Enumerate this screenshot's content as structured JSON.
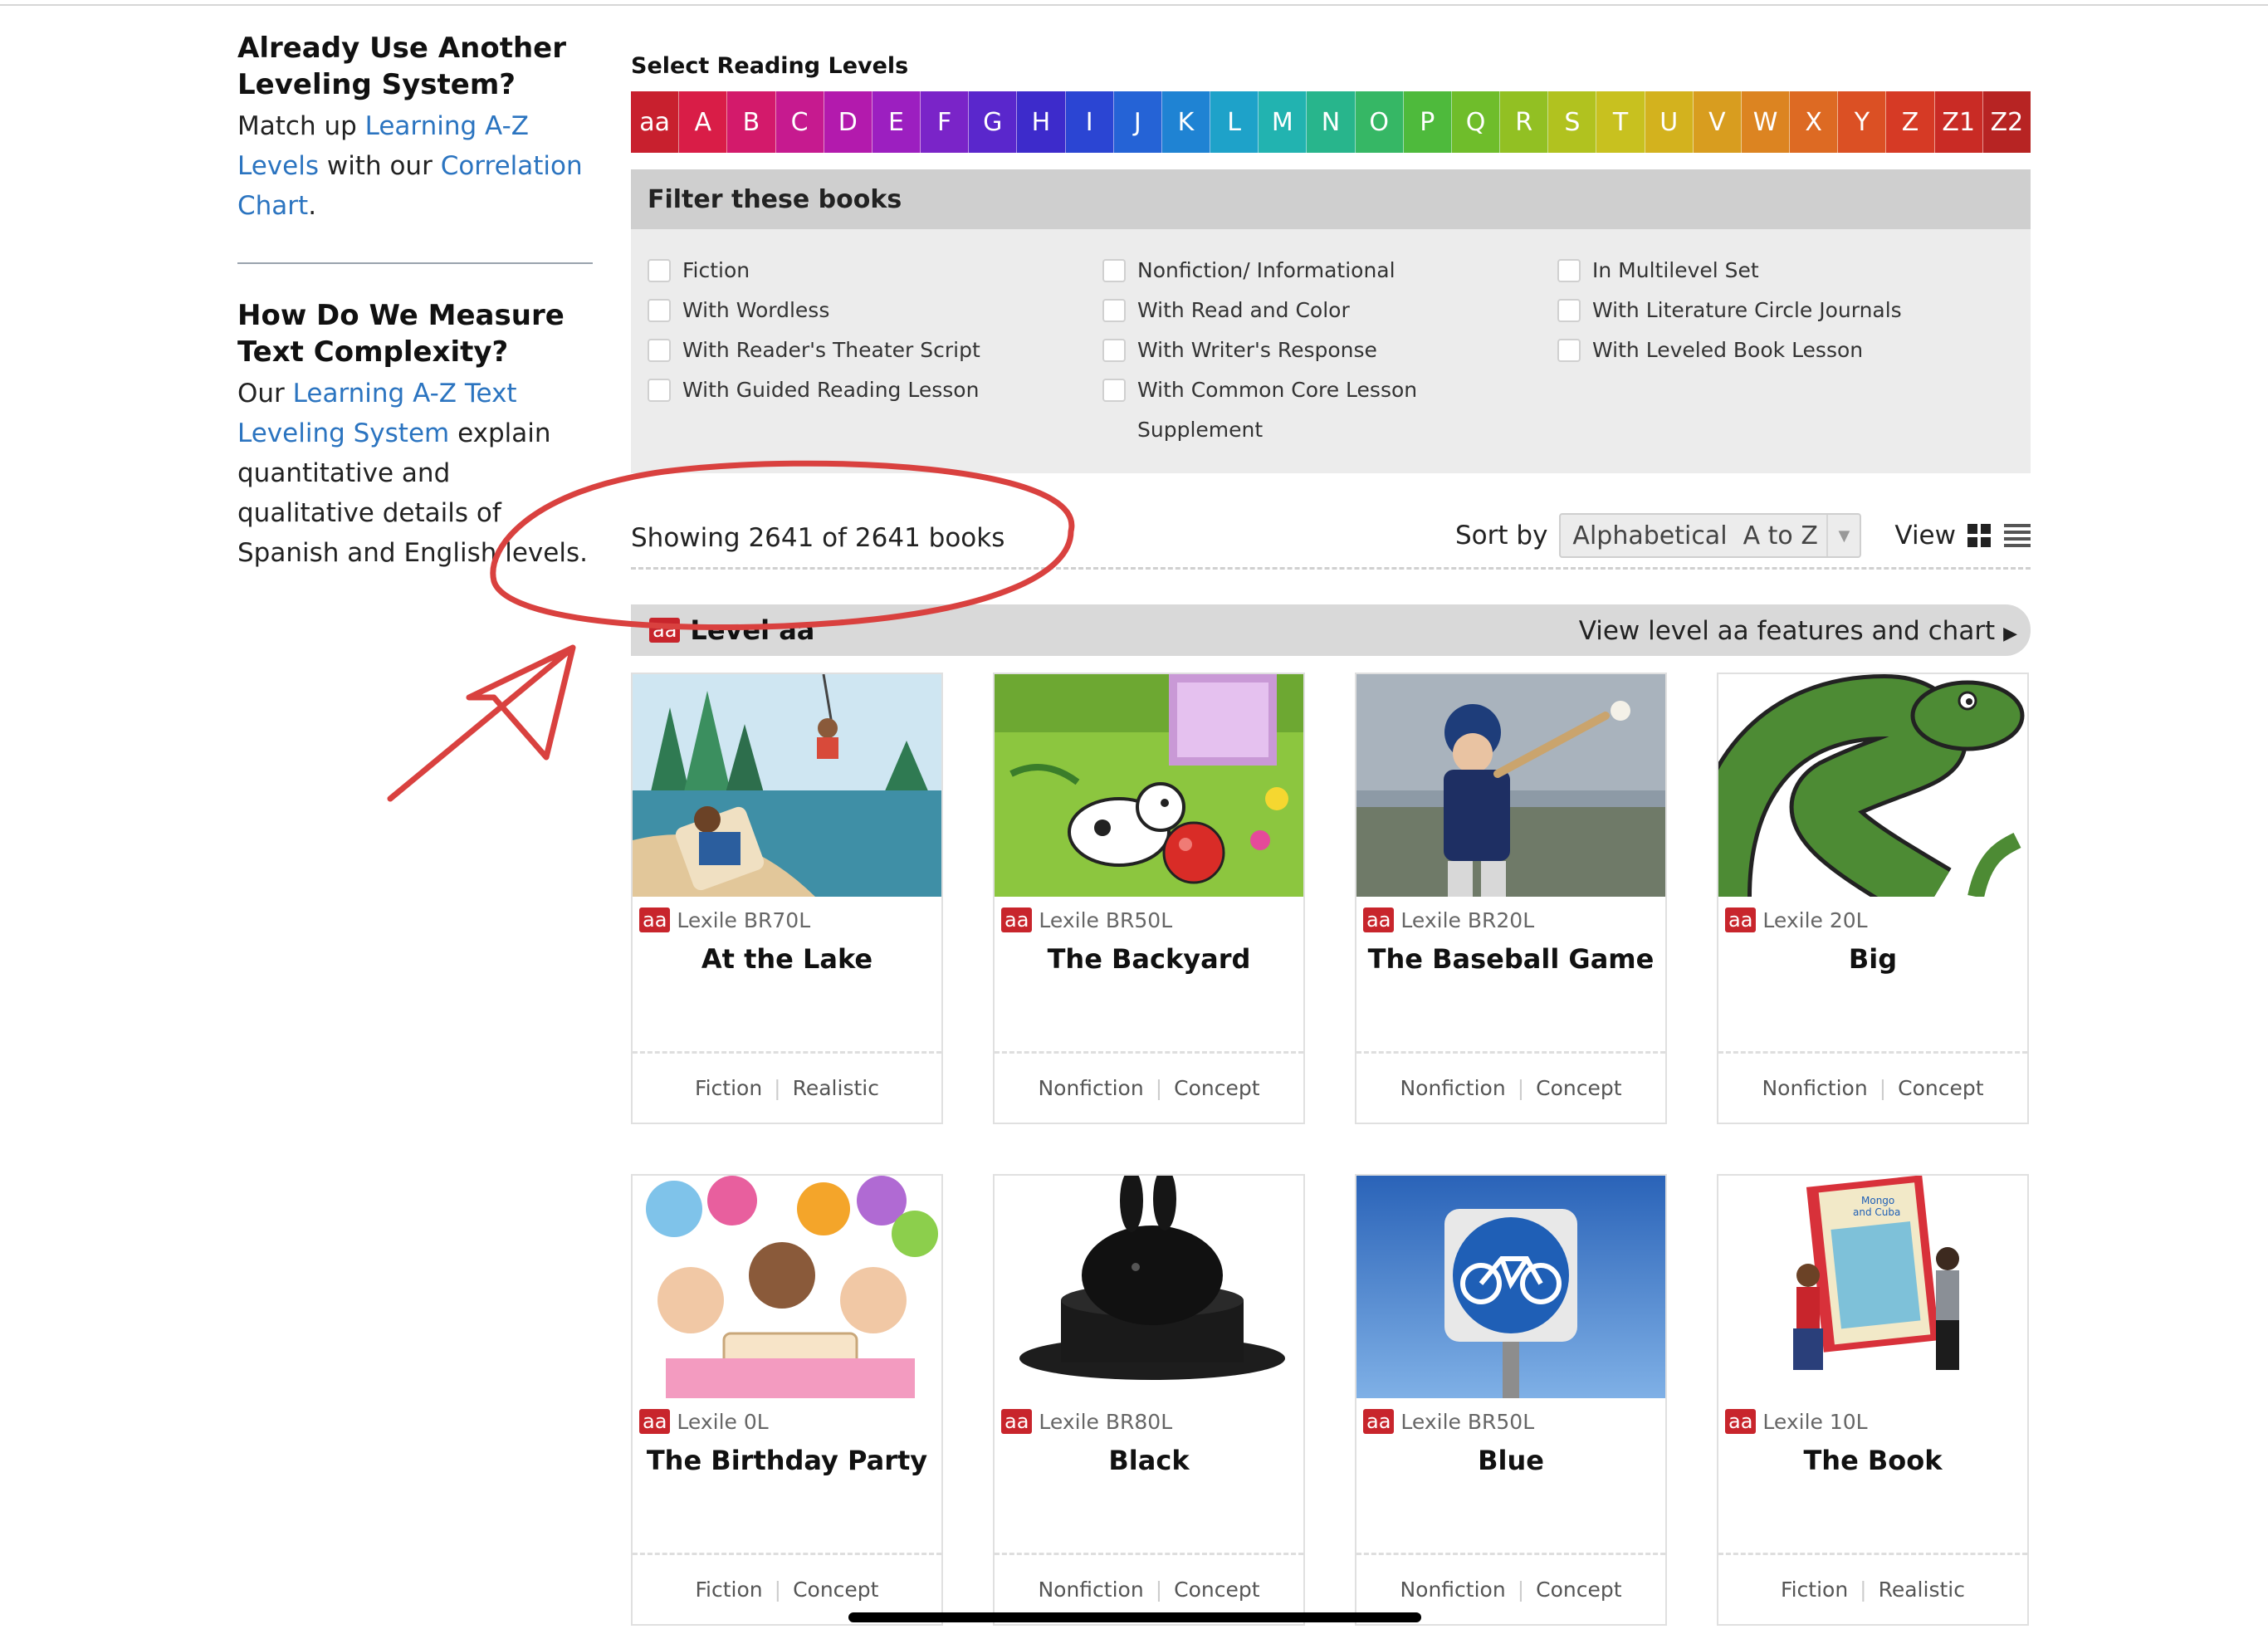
{
  "sidebar": {
    "section1_title": "Already Use Another Leveling System?",
    "section1_text_1": "Match up ",
    "section1_link_1": "Learning A-Z Levels",
    "section1_text_2": " with our ",
    "section1_link_2": "Correlation Chart",
    "section1_text_3": ".",
    "section2_title": "How Do We Measure Text Complexity?",
    "section2_text_1": "Our ",
    "section2_link_1": "Learning A-Z Text Leveling System",
    "section2_text_2": " explain quantitative and qualitative details of Spanish and English levels."
  },
  "levels": {
    "label": "Select Reading Levels",
    "items": [
      {
        "label": "aa",
        "color": "#c8202e"
      },
      {
        "label": "A",
        "color": "#d91d47"
      },
      {
        "label": "B",
        "color": "#d31a6b"
      },
      {
        "label": "C",
        "color": "#c61a8f"
      },
      {
        "label": "D",
        "color": "#b31aad"
      },
      {
        "label": "E",
        "color": "#9c1fc0"
      },
      {
        "label": "F",
        "color": "#7a24c8"
      },
      {
        "label": "G",
        "color": "#5a27cc"
      },
      {
        "label": "H",
        "color": "#3d2bcb"
      },
      {
        "label": "I",
        "color": "#2b45d3"
      },
      {
        "label": "J",
        "color": "#2563d6"
      },
      {
        "label": "K",
        "color": "#1f83d3"
      },
      {
        "label": "L",
        "color": "#1ea2c9"
      },
      {
        "label": "M",
        "color": "#22b3b0"
      },
      {
        "label": "N",
        "color": "#28b58c"
      },
      {
        "label": "O",
        "color": "#36b765"
      },
      {
        "label": "P",
        "color": "#4eba3c"
      },
      {
        "label": "Q",
        "color": "#6fbd2b"
      },
      {
        "label": "R",
        "color": "#92c023"
      },
      {
        "label": "S",
        "color": "#b1c21f"
      },
      {
        "label": "T",
        "color": "#c8c11f"
      },
      {
        "label": "U",
        "color": "#d3b21e"
      },
      {
        "label": "V",
        "color": "#d89d1f"
      },
      {
        "label": "W",
        "color": "#dc8421"
      },
      {
        "label": "X",
        "color": "#dd6a23"
      },
      {
        "label": "Y",
        "color": "#db5024"
      },
      {
        "label": "Z",
        "color": "#d63a25"
      },
      {
        "label": "Z1",
        "color": "#c92b25"
      },
      {
        "label": "Z2",
        "color": "#b72423"
      }
    ]
  },
  "filter": {
    "title": "Filter these books",
    "col1": [
      "Fiction",
      "With Wordless",
      "With Reader's Theater Script",
      "With Guided Reading Lesson"
    ],
    "col2": [
      "Nonfiction/ Informational",
      "With Read and Color",
      "With Writer's Response",
      "With Common Core Lesson Supplement"
    ],
    "col3": [
      "In Multilevel Set",
      "With Literature Circle Journals",
      "With Leveled Book Lesson"
    ]
  },
  "results": {
    "showing": "Showing 2641 of 2641 books",
    "sort_label": "Sort by",
    "sort_value": "Alphabetical  A to Z",
    "view_label": "View"
  },
  "level_section": {
    "badge": "aa",
    "title": "Level aa",
    "link": "View level aa features and chart"
  },
  "books": [
    {
      "badge": "aa",
      "lexile": "Lexile BR70L",
      "title": "At the Lake",
      "tag1": "Fiction",
      "tag2": "Realistic"
    },
    {
      "badge": "aa",
      "lexile": "Lexile BR50L",
      "title": "The Backyard",
      "tag1": "Nonfiction",
      "tag2": "Concept"
    },
    {
      "badge": "aa",
      "lexile": "Lexile BR20L",
      "title": "The Baseball Game",
      "tag1": "Nonfiction",
      "tag2": "Concept"
    },
    {
      "badge": "aa",
      "lexile": "Lexile 20L",
      "title": "Big",
      "tag1": "Nonfiction",
      "tag2": "Concept"
    },
    {
      "badge": "aa",
      "lexile": "Lexile 0L",
      "title": "The Birthday Party",
      "tag1": "Fiction",
      "tag2": "Concept"
    },
    {
      "badge": "aa",
      "lexile": "Lexile BR80L",
      "title": "Black",
      "tag1": "Nonfiction",
      "tag2": "Concept"
    },
    {
      "badge": "aa",
      "lexile": "Lexile BR50L",
      "title": "Blue",
      "tag1": "Nonfiction",
      "tag2": "Concept"
    },
    {
      "badge": "aa",
      "lexile": "Lexile 10L",
      "title": "The Book",
      "tag1": "Fiction",
      "tag2": "Realistic"
    }
  ],
  "cover_mini": {
    "line1": "Mongo",
    "line2": "and Cuba"
  },
  "colors": {
    "accent_red": "#c8252c",
    "link_blue": "#2b74c0",
    "annotation_red": "#d9413f"
  }
}
